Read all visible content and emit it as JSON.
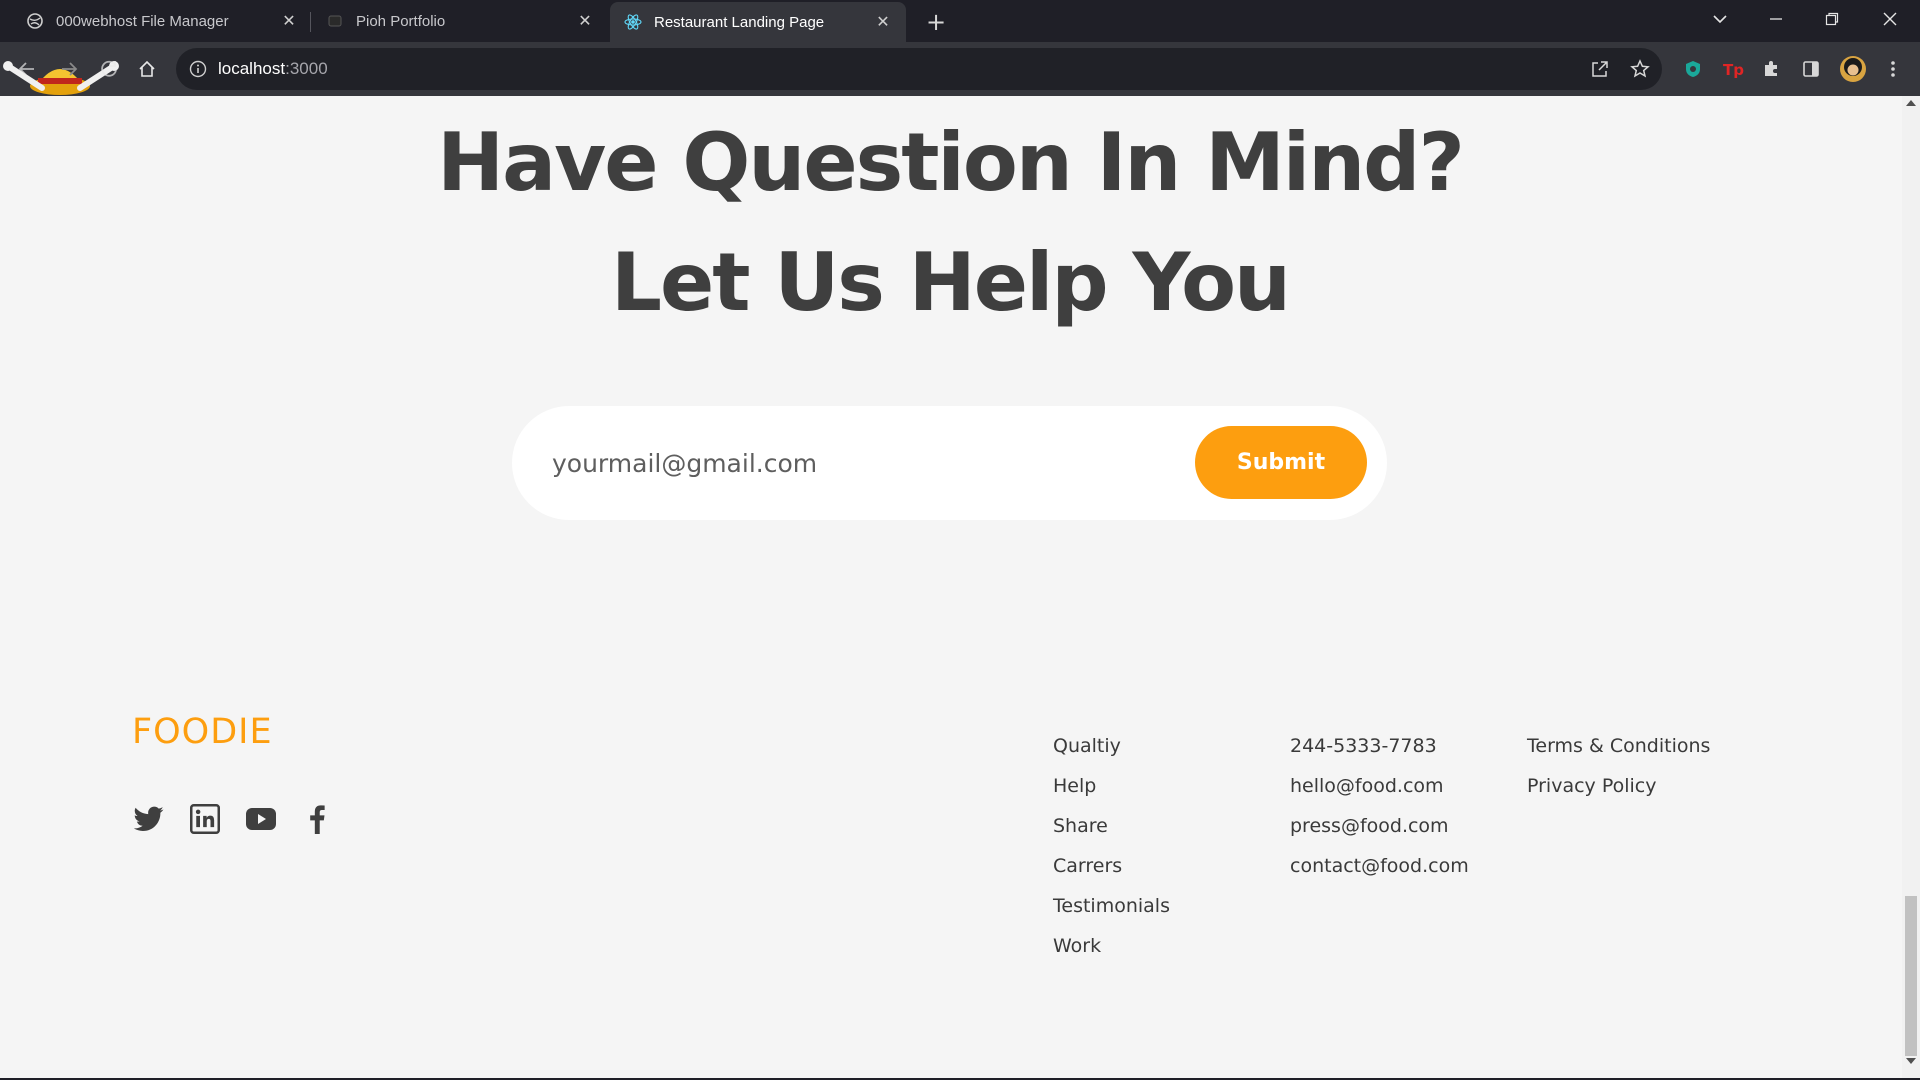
{
  "browser": {
    "tabs": [
      {
        "title": "000webhost File Manager",
        "icon": "globe-icon"
      },
      {
        "title": "Pioh Portfolio",
        "icon": "portfolio-icon"
      },
      {
        "title": "Restaurant Landing Page",
        "icon": "react-icon",
        "active": true
      }
    ],
    "url_host": "localhost",
    "url_port": ":3000"
  },
  "page": {
    "headline_line1": "Have Question In Mind?",
    "headline_line2": "Let Us Help You",
    "subscribe": {
      "placeholder": "yourmail@gmail.com",
      "submit_label": "Submit"
    },
    "footer": {
      "brand": "FOODIE",
      "brand_color": "#fd9e0f",
      "socials": [
        "twitter-icon",
        "linkedin-icon",
        "youtube-icon",
        "facebook-icon"
      ],
      "links_col1": [
        "Qualtiy",
        "Help",
        "Share",
        "Carrers",
        "Testimonials",
        "Work"
      ],
      "contact_col": [
        "244-5333-7783",
        "hello@food.com",
        "press@food.com",
        "contact@food.com"
      ],
      "legal_col": [
        "Terms & Conditions",
        "Privacy Policy"
      ]
    }
  },
  "colors": {
    "accent": "#fd9e0f",
    "page_bg": "#f5f5f5",
    "heading": "#3f3f3f"
  }
}
